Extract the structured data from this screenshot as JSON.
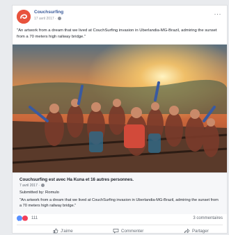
{
  "post": {
    "page_name": "Couchsurfing",
    "date": "17 avril 2017 ·",
    "caption": "\"An artwork from a dream that we lived at CouchSurfing invasion in Uberlandia-MG-Brazil, admiring the sunset from a 70 meters high railway bridge.\""
  },
  "shared": {
    "header": "Couchsurfing est avec Ha Kuna et 16 autres personnes.",
    "date": "7 avril 2017 ·",
    "submitted_by": "Submitted by: Romulo",
    "quote": "\"An artwork from a dream that we lived at CouchSurfing invasion in Uberlandia-MG-Brazil, admiring the sunset from a 70 meters high railway bridge.\""
  },
  "stats": {
    "reactions": "111",
    "comments": "3 commentaires"
  },
  "actions": {
    "like": "J'aime",
    "comment": "Commenter",
    "share": "Partager"
  },
  "colors": {
    "link": "#365899",
    "brand": "#e8533d",
    "like": "#5890ff",
    "love": "#f33e58"
  },
  "icons": [
    "couchsurfing-logo",
    "globe-icon",
    "more-icon",
    "like-icon",
    "love-icon",
    "thumbs-up-icon",
    "comment-icon",
    "share-icon"
  ]
}
